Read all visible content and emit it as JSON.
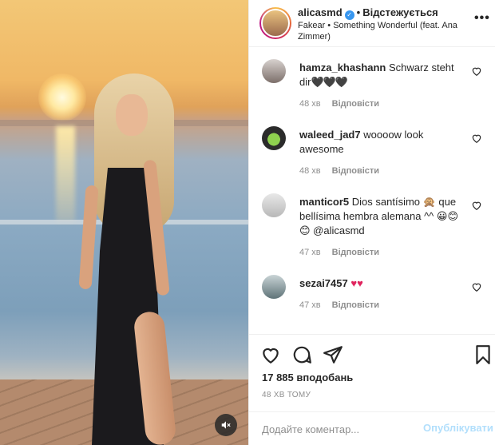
{
  "post": {
    "username": "alicasmd",
    "follow_status": "Відстежується",
    "song": "Fakear • Something Wonderful (feat. Ana Zimmer)",
    "more_label": "•••"
  },
  "comments": [
    {
      "username": "hamza_khashann",
      "text": "Schwarz steht dir",
      "emoji": "🖤🖤🖤",
      "time": "48 хв",
      "reply": "Відповісти"
    },
    {
      "username": "waleed_jad7",
      "text": "woooow look awesome",
      "emoji": "",
      "time": "48 хв",
      "reply": "Відповісти"
    },
    {
      "username": "manticor5",
      "text": "Dios santísimo 🙊 que bellísima hembra alemana ^^ 😀😊😊 @alicasmd",
      "emoji": "",
      "time": "47 хв",
      "reply": "Відповісти"
    },
    {
      "username": "sezai7457",
      "text": "",
      "emoji": "♥♥",
      "time": "47 хв",
      "reply": "Відповісти"
    }
  ],
  "stats": {
    "likes": "17 885 вподобань",
    "posted": "48 ХВ ТОМУ"
  },
  "comment_box": {
    "placeholder": "Додайте коментар...",
    "post_label": "Опублікувати"
  },
  "icons": {
    "verified": "verified-badge-icon",
    "like": "heart-icon",
    "comment": "comment-bubble-icon",
    "share": "paper-plane-icon",
    "save": "bookmark-icon",
    "mute": "speaker-muted-icon"
  },
  "colors": {
    "verified": "#3897f0",
    "post_button": "#b2dffc",
    "meta_text": "#8e8e8e"
  }
}
